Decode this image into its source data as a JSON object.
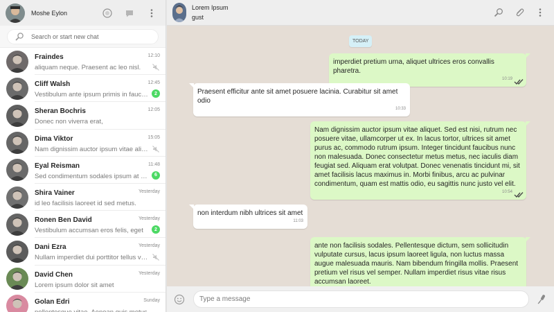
{
  "sidebar": {
    "user_name": "Moshe Eylon",
    "search_placeholder": "Search or start new chat",
    "chats": [
      {
        "name": "Fraindes",
        "time": "12:10",
        "preview": "aliquam neque. Praesent ac leo nisl.",
        "indicator": "muted",
        "unread": "",
        "avatar_color": "#6f6a6a"
      },
      {
        "name": "Cliff Walsh",
        "time": "12:45",
        "preview": "Vestibulum ante ipsum primis in faucibus",
        "indicator": "badge",
        "unread": "2",
        "avatar_color": "#6b6b6b"
      },
      {
        "name": "Sheran Bochris",
        "time": "12:05",
        "preview": "Donec non viverra erat,",
        "indicator": "none",
        "unread": "",
        "avatar_color": "#5f5f5f"
      },
      {
        "name": "Dima Viktor",
        "time": "15:05",
        "preview": "Nam dignissim auctor ipsum vitae aliquet.",
        "indicator": "muted",
        "unread": "",
        "avatar_color": "#666666"
      },
      {
        "name": "Eyal Reisman",
        "time": "11:48",
        "preview": "Sed condimentum sodales ipsum at aliquet",
        "indicator": "badge",
        "unread": "6",
        "avatar_color": "#6a6a6a"
      },
      {
        "name": "Shira Vainer",
        "time": "Yesterday",
        "preview": "id leo facilisis laoreet id sed metus.",
        "indicator": "none",
        "unread": "",
        "avatar_color": "#707070"
      },
      {
        "name": "Ronen Ben David",
        "time": "Yesterday",
        "preview": "Vestibulum accumsan eros felis, eget",
        "indicator": "badge",
        "unread": "2",
        "avatar_color": "#646464"
      },
      {
        "name": "Dani Ezra",
        "time": "Yesterday",
        "preview": "Nullam imperdiet dui porttitor tellus volutpat",
        "indicator": "muted",
        "unread": "",
        "avatar_color": "#5c5c5c"
      },
      {
        "name": "David Chen",
        "time": "Yesterday",
        "preview": "Lorem ipsum dolor sit amet",
        "indicator": "none",
        "unread": "",
        "avatar_color": "#6a8a55"
      },
      {
        "name": "Golan Edri",
        "time": "Sunday",
        "preview": "pellentesque vitae. Aenean quis metus",
        "indicator": "none",
        "unread": "",
        "avatar_color": "#d98aa0"
      }
    ]
  },
  "conversation": {
    "title": "Lorem Ipsum",
    "status": "gust",
    "day_label": "TODAY",
    "messages": [
      {
        "dir": "out",
        "text": "imperdiet pretium urna, aliquet ultrices eros convallis pharetra.",
        "time": "10:19"
      },
      {
        "dir": "in",
        "text": "Praesent efficitur ante sit amet posuere lacinia. Curabitur sit amet odio",
        "time": "10:33"
      },
      {
        "dir": "out",
        "text": "Nam dignissim auctor ipsum vitae aliquet. Sed est nisi, rutrum nec posuere vitae, ullamcorper ut ex. In lacus tortor, ultrices sit amet purus ac, commodo rutrum ipsum. Integer tincidunt faucibus nunc non malesuada. Donec consectetur metus metus, nec iaculis diam feugiat sed. Aliquam erat volutpat. Donec venenatis tincidunt mi, sit amet facilisis lacus maximus in. Morbi finibus, arcu ac pulvinar condimentum, quam est mattis odio, eu sagittis nunc justo vel elit.",
        "time": "10:54"
      },
      {
        "dir": "in",
        "text": "non interdum nibh ultrices sit amet",
        "time": "11:03"
      },
      {
        "dir": "out",
        "text": "ante non facilisis sodales. Pellentesque dictum, sem sollicitudin vulputate cursus, lacus ipsum laoreet ligula, non luctus massa augue malesuada mauris. Nam bibendum fringilla mollis. Praesent pretium vel risus vel semper. Nullam imperdiet risus vitae risus accumsan laoreet.",
        "time": ""
      }
    ]
  },
  "composer": {
    "placeholder": "Type a message"
  },
  "icons": {
    "status": "status-icon",
    "new_chat": "chat-icon",
    "menu": "menu-dots-icon",
    "search": "search-icon",
    "attach": "paperclip-icon",
    "emoji": "emoji-icon",
    "mic": "microphone-icon",
    "muted": "muted-icon",
    "read_receipt": "double-check-icon"
  },
  "colors": {
    "outgoing_bubble": "#dcf8c6",
    "incoming_bubble": "#ffffff",
    "unread_badge": "#4cd964",
    "read_ticks": "#4a4a4a",
    "chat_background": "#e5ddd5"
  }
}
